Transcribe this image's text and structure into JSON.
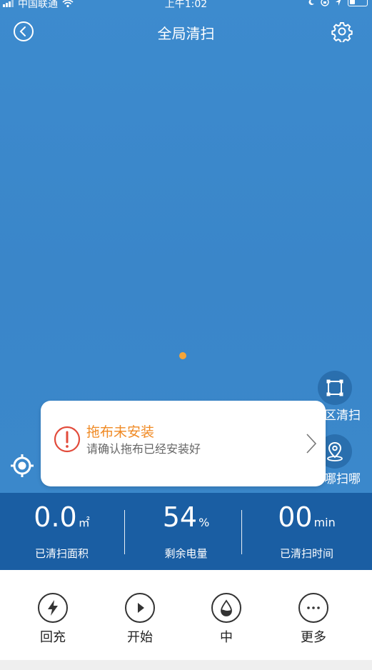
{
  "status_bar": {
    "carrier": "中国联通",
    "time": "上午1:02"
  },
  "header": {
    "title": "全局清扫"
  },
  "map_actions": {
    "zone_clean_label": "区清扫",
    "spot_clean_label": "哪扫哪"
  },
  "alert": {
    "title": "拖布未安装",
    "message": "请确认拖布已经安装好"
  },
  "stats": {
    "area": {
      "value": "0.0",
      "unit": "㎡",
      "label": "已清扫面积"
    },
    "battery": {
      "value": "54",
      "unit": "%",
      "label": "剩余电量"
    },
    "time": {
      "value": "00",
      "unit": "min",
      "label": "已清扫时间"
    }
  },
  "controls": {
    "recharge_label": "回充",
    "start_label": "开始",
    "suction_label": "中",
    "more_label": "更多"
  },
  "colors": {
    "map_blue": "#3b88cb",
    "stats_blue": "#1a5ea3",
    "alert_orange": "#f08a24",
    "alert_red": "#e24b3b",
    "robot_dot": "#f4a53a"
  },
  "icons": {
    "back": "back-icon",
    "settings": "gear-icon",
    "zone": "crop-square-icon",
    "spot": "location-pin-icon",
    "locate": "target-icon",
    "alert": "exclamation-circle-icon",
    "chevron": "chevron-right-icon",
    "recharge": "lightning-icon",
    "start": "play-icon",
    "suction": "water-drop-icon",
    "more": "ellipsis-icon"
  }
}
